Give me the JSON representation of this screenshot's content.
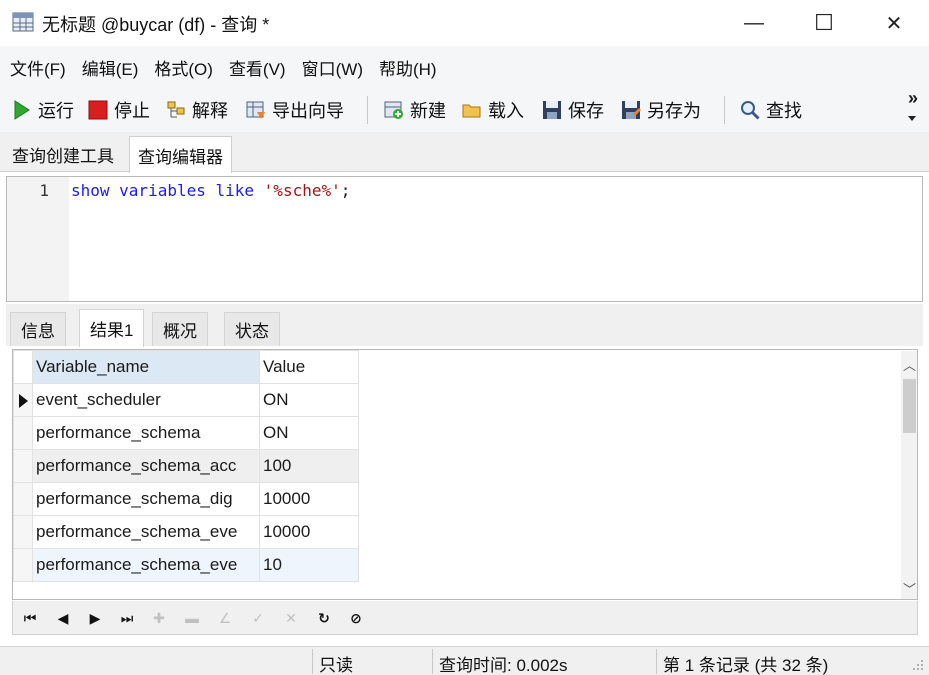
{
  "window": {
    "title": "无标题 @buycar (df) - 查询 *",
    "minimize_glyph": "—",
    "maximize_glyph": "☐",
    "close_glyph": "✕"
  },
  "menu": [
    "文件(F)",
    "编辑(E)",
    "格式(O)",
    "查看(V)",
    "窗口(W)",
    "帮助(H)"
  ],
  "toolbar": {
    "run": "运行",
    "stop": "停止",
    "explain": "解释",
    "export_wizard": "导出向导",
    "new": "新建",
    "load": "载入",
    "save": "保存",
    "save_as": "另存为",
    "find": "查找",
    "overflow": "»"
  },
  "top_tabs": [
    "查询创建工具",
    "查询编辑器"
  ],
  "editor": {
    "line_number": "1",
    "keywords": "show variables like",
    "string": "'%sche%'",
    "terminator": ";"
  },
  "result_tabs": [
    "信息",
    "结果1",
    "概况",
    "状态"
  ],
  "grid": {
    "columns": [
      "Variable_name",
      "Value"
    ],
    "rows": [
      [
        "event_scheduler",
        "ON"
      ],
      [
        "performance_schema",
        "ON"
      ],
      [
        "performance_schema_acc",
        "100"
      ],
      [
        "performance_schema_dig",
        "10000"
      ],
      [
        "performance_schema_eve",
        "10000"
      ],
      [
        "performance_schema_eve",
        "10"
      ]
    ]
  },
  "status": {
    "readonly": "只读",
    "query_time": "查询时间: 0.002s",
    "record": "第 1 条记录 (共 32 条)"
  },
  "colors": {
    "keyword": "#1a1aff",
    "string": "#a31515",
    "stop_red": "#d81e1e",
    "run_green": "#2fa82f"
  }
}
